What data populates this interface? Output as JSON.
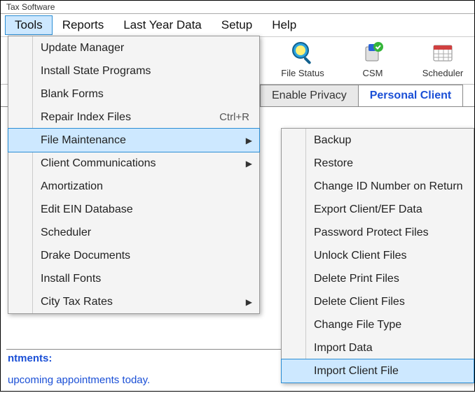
{
  "window": {
    "title": "Tax Software"
  },
  "menubar": {
    "tools": "Tools",
    "reports": "Reports",
    "lastyear": "Last Year Data",
    "setup": "Setup",
    "help": "Help"
  },
  "toolbar": {
    "filestatus": "File Status",
    "csm": "CSM",
    "scheduler": "Scheduler"
  },
  "tabs": {
    "enable_privacy": "Enable Privacy",
    "personal_client": "Personal Client"
  },
  "panel": {
    "heading": "ntments:",
    "text": "upcoming appointments today."
  },
  "tools_menu": {
    "update_manager": "Update Manager",
    "install_state": "Install State Programs",
    "blank_forms": "Blank Forms",
    "repair_index": "Repair Index Files",
    "repair_index_shortcut": "Ctrl+R",
    "file_maintenance": "File Maintenance",
    "client_comm": "Client Communications",
    "amortization": "Amortization",
    "edit_ein": "Edit EIN Database",
    "scheduler": "Scheduler",
    "drake_docs": "Drake Documents",
    "install_fonts": "Install Fonts",
    "city_tax": "City Tax Rates"
  },
  "file_maint_menu": {
    "backup": "Backup",
    "restore": "Restore",
    "change_id": "Change ID Number on Return",
    "export_client": "Export Client/EF Data",
    "password_protect": "Password Protect Files",
    "unlock_client": "Unlock Client Files",
    "delete_print": "Delete Print Files",
    "delete_client": "Delete Client Files",
    "change_file_type": "Change File Type",
    "import_data": "Import Data",
    "import_client_file": "Import Client File"
  },
  "glyphs": {
    "submenu_arrow": "▶"
  }
}
